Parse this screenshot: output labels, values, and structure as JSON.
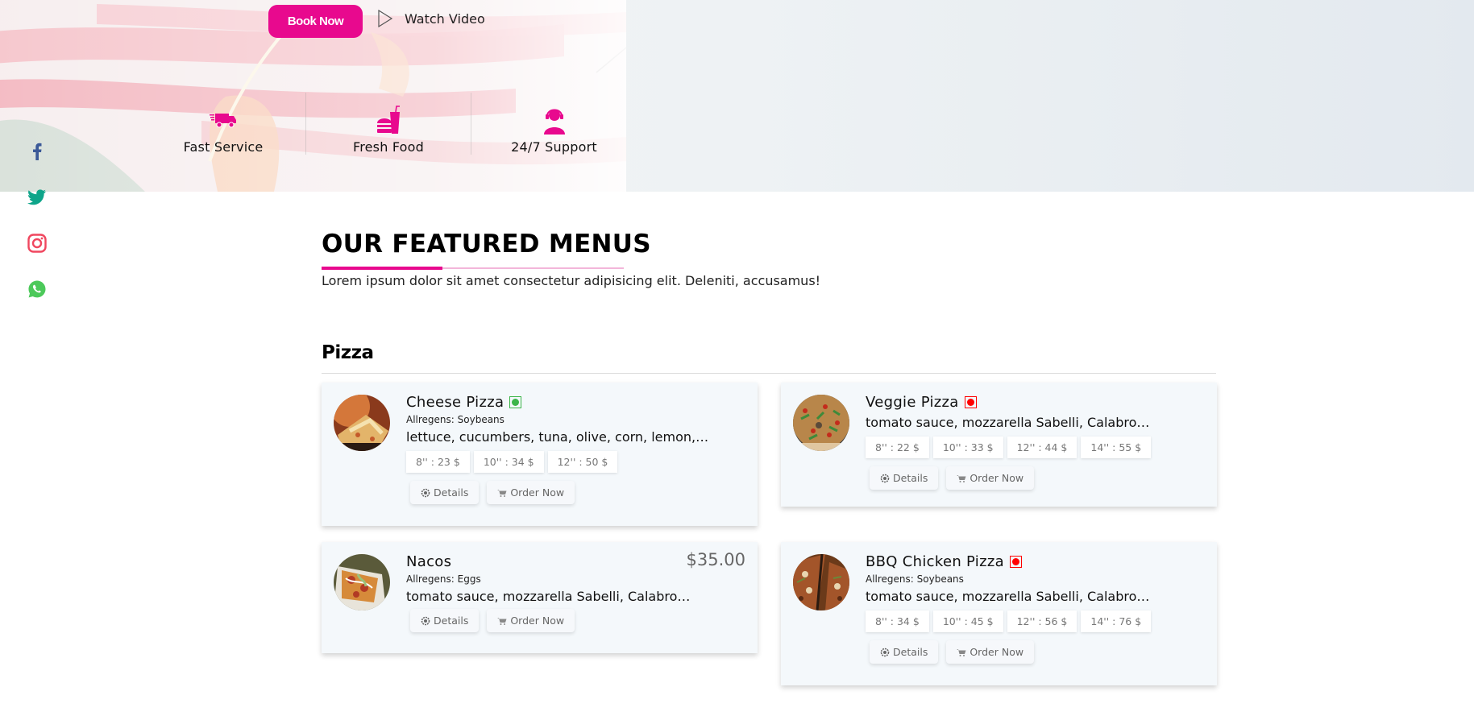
{
  "hero": {
    "book_now_label": "Book Now",
    "watch_video_label": "Watch Video",
    "features": [
      {
        "icon": "delivery-truck-icon",
        "label": "Fast Service"
      },
      {
        "icon": "burger-drink-icon",
        "label": "Fresh Food"
      },
      {
        "icon": "support-agent-icon",
        "label": "24/7 Support"
      }
    ]
  },
  "social": [
    {
      "name": "facebook",
      "color": "#3b5998"
    },
    {
      "name": "twitter",
      "color": "#0ea58a"
    },
    {
      "name": "instagram",
      "color": "#f0475f"
    },
    {
      "name": "whatsapp",
      "color": "#4cc95a"
    }
  ],
  "section": {
    "title": "OUR FEATURED MENUS",
    "subtitle": "Lorem ipsum dolor sit amet consectetur adipisicing elit. Deleniti, accusamus!"
  },
  "category": {
    "title": "Pizza"
  },
  "colors": {
    "accent": "#e8098e",
    "veg": "#3cb54a",
    "nonveg": "#ff0000",
    "card_bg": "#f4f8fb"
  },
  "labels": {
    "details": "Details",
    "order_now": "Order Now",
    "allergens_prefix": "Allregens: "
  },
  "items": [
    {
      "name": "Cheese Pizza",
      "veg_type": "veg",
      "allergens": "Allregens: Soybeans",
      "description": "lettuce, cucumbers, tuna, olive, corn, lemon,…",
      "sizes": [
        "8'' : 23 $",
        "10'' : 34 $",
        "12'' : 50 $"
      ],
      "price": ""
    },
    {
      "name": "Veggie Pizza",
      "veg_type": "nonveg",
      "allergens": "",
      "description": "tomato sauce, mozzarella Sabelli, Calabro…",
      "sizes": [
        "8'' : 22 $",
        "10'' : 33 $",
        "12'' : 44 $",
        "14'' : 55 $"
      ],
      "price": ""
    },
    {
      "name": "Nacos",
      "veg_type": "",
      "allergens": "Allregens: Eggs",
      "description": "tomato sauce, mozzarella Sabelli, Calabro…",
      "sizes": [],
      "price": "$35.00"
    },
    {
      "name": "BBQ Chicken Pizza",
      "veg_type": "nonveg",
      "allergens": "Allregens: Soybeans",
      "description": "tomato sauce, mozzarella Sabelli, Calabro…",
      "sizes": [
        "8'' : 34 $",
        "10'' : 45 $",
        "12'' : 56 $",
        "14'' : 76 $"
      ],
      "price": ""
    }
  ]
}
